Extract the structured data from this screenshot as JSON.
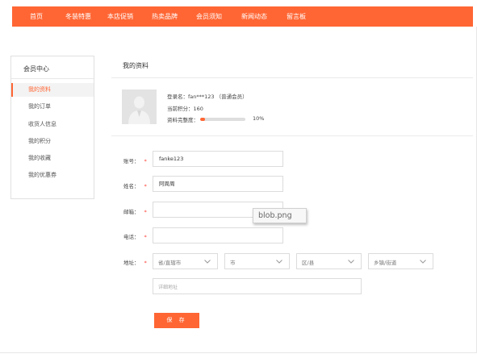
{
  "colors": {
    "accent": "#ff6634",
    "required": "#ff3b30"
  },
  "nav": {
    "items": [
      {
        "label": "首页"
      },
      {
        "label": "冬装特惠"
      },
      {
        "label": "本店促销"
      },
      {
        "label": "热卖品牌"
      },
      {
        "label": "会员须知"
      },
      {
        "label": "新闻动态"
      },
      {
        "label": "留言板"
      }
    ]
  },
  "sidebar": {
    "title": "会员中心",
    "items": [
      {
        "label": "我的资料",
        "active": true
      },
      {
        "label": "我的订单"
      },
      {
        "label": "收货人信息"
      },
      {
        "label": "我的积分"
      },
      {
        "label": "我的收藏"
      },
      {
        "label": "我的优惠券"
      }
    ]
  },
  "profile": {
    "title": "我的资料",
    "avatar_icon": "user-avatar-icon",
    "login_name": "登录名：fan***123 （普通会员）",
    "points": "当前积分：160",
    "completeness_label": "资料完整度：",
    "completeness": 0.1,
    "completeness_text": "10%"
  },
  "form": {
    "required_mark": "*",
    "account": {
      "label": "账号：",
      "value": "fanke123"
    },
    "name": {
      "label": "姓名：",
      "value": "阿周周"
    },
    "email": {
      "label": "邮箱：",
      "value": ""
    },
    "phone": {
      "label": "电话：",
      "value": ""
    },
    "address": {
      "label": "地址：",
      "province": "省/直辖市",
      "city": "市",
      "district": "区/县",
      "town": "乡镇/街道",
      "detail_placeholder": "详细地址"
    },
    "save_label": "保 存"
  },
  "overlay": {
    "label": "blob.png"
  }
}
